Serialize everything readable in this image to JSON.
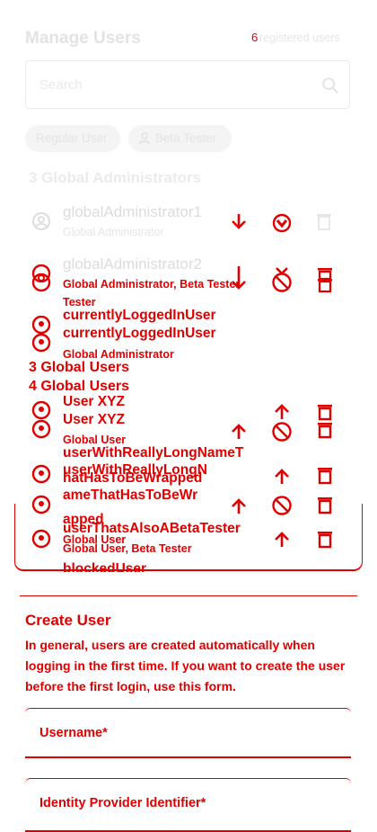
{
  "header": {
    "title": "Manage Users",
    "registered_count": "6",
    "registered_label": "registered users"
  },
  "search": {
    "placeholder": "Search"
  },
  "filters": {
    "regular": "Regular User",
    "beta": "Beta Tester"
  },
  "faded_section": {
    "heading": "3 Global Administrators",
    "row1": {
      "name": "globalAdministrator1",
      "role": "Global Administrator"
    },
    "row2": {
      "name": "globalAdministrator2"
    }
  },
  "overlay": {
    "row_ga_role": "Global Administrator, Beta",
    "row_ga_role_tester_inline": "Tester",
    "row_ga_role_tester": "Tester",
    "current_user": "currentlyLoggedInUser",
    "current_user_dup": "currentlyLoggedInUser",
    "current_user_role": "Global Administrator",
    "sect_admins": "3 Global Users",
    "sect_users": "4 Global Users",
    "user_xyz": "User XYZ",
    "user_xyz_dup": "User XYZ",
    "user_xyz_role": "Global User",
    "long_name_1": "userWithReallyLongNameT",
    "long_name_2": "hatHasToBeWrapped",
    "long_name_alt_1": "userWithReallyLongN",
    "long_name_alt_2": "ameThatHasToBeWr",
    "long_name_alt_3": "apped",
    "long_role": "Global User",
    "beta_user": "userThatsAlsoABetaTester",
    "beta_user_role": "Global User, Beta Tester",
    "blocked_user": "blockedUser"
  },
  "create": {
    "title": "Create User",
    "description": "In general, users are created automatically when logging in the first time. If you want to create the user before the first login, use this form.",
    "username_label": "Username*",
    "idp_label": "Identity Provider Identifier*"
  },
  "colors": {
    "accent": "#e00000",
    "faded": "#e6e6e6"
  }
}
